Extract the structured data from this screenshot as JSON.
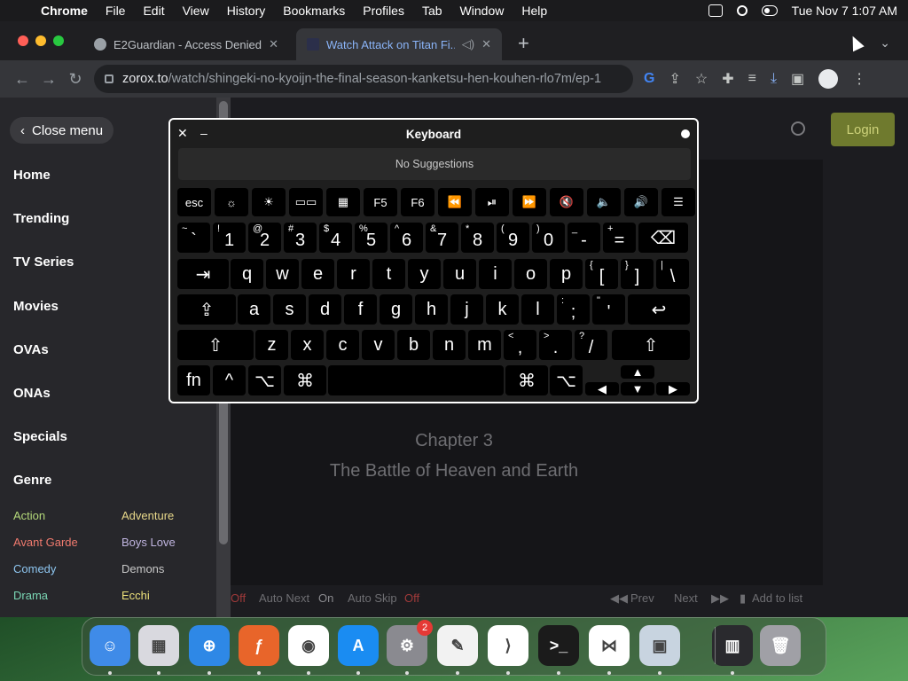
{
  "menubar": {
    "app_name": "Chrome",
    "items": [
      "File",
      "Edit",
      "View",
      "History",
      "Bookmarks",
      "Profiles",
      "Tab",
      "Window",
      "Help"
    ],
    "datetime": "Tue Nov 7  1:07 AM"
  },
  "browser": {
    "tabs": [
      {
        "title": "E2Guardian - Access Denied",
        "active": false
      },
      {
        "title": "Watch Attack on Titan Fi...",
        "active": true
      }
    ],
    "new_tab": "+",
    "url_host": "zorox.to",
    "url_path": "/watch/shingeki-no-kyoijn-the-final-season-kanketsu-hen-kouhen-rlo7m/ep-1"
  },
  "site": {
    "close_menu": "Close menu",
    "nav": [
      "Home",
      "Trending",
      "TV Series",
      "Movies",
      "OVAs",
      "ONAs",
      "Specials",
      "Genre"
    ],
    "genres_left": [
      "Action",
      "Avant Garde",
      "Comedy",
      "Drama"
    ],
    "genres_right": [
      "Adventure",
      "Boys Love",
      "Demons",
      "Ecchi"
    ],
    "genre_colors": {
      "Action": "#b4d97a",
      "Adventure": "#e8d88a",
      "Avant Garde": "#f07a6e",
      "Boys Love": "#c0b5e0",
      "Comedy": "#8ec6f0",
      "Demons": "#c8c8c8",
      "Drama": "#7ad6b4",
      "Ecchi": "#ece07a"
    },
    "login": "Login",
    "chapter": "Chapter 3",
    "chapter_title": "The Battle of Heaven and Earth",
    "controls": {
      "off1": "Off",
      "auto_next": "Auto Next",
      "auto_next_state": "On",
      "auto_skip": "Auto Skip",
      "auto_skip_state": "Off",
      "prev": "Prev",
      "next": "Next",
      "add_to_list": "Add to list"
    }
  },
  "keyboard": {
    "title": "Keyboard",
    "suggestions": "No Suggestions",
    "row_fn": [
      "esc",
      "☼",
      "☀",
      "▭▭",
      "▦",
      "F5",
      "F6",
      "⏪",
      "⏯",
      "⏩",
      "🔇",
      "🔈",
      "🔊",
      "☰"
    ],
    "row_num": [
      {
        "top": "~",
        "ch": "`"
      },
      {
        "top": "!",
        "ch": "1"
      },
      {
        "top": "@",
        "ch": "2"
      },
      {
        "top": "#",
        "ch": "3"
      },
      {
        "top": "$",
        "ch": "4"
      },
      {
        "top": "%",
        "ch": "5"
      },
      {
        "top": "^",
        "ch": "6"
      },
      {
        "top": "&",
        "ch": "7"
      },
      {
        "top": "*",
        "ch": "8"
      },
      {
        "top": "(",
        "ch": "9"
      },
      {
        "top": ")",
        "ch": "0"
      },
      {
        "top": "_",
        "ch": "-"
      },
      {
        "top": "+",
        "ch": "="
      },
      {
        "top": "",
        "ch": "⌫"
      }
    ],
    "row_q": [
      "⇥",
      "q",
      "w",
      "e",
      "r",
      "t",
      "y",
      "u",
      "i",
      "o",
      "p",
      "{[",
      "}]",
      "|\\"
    ],
    "row_a": [
      "⇪",
      "a",
      "s",
      "d",
      "f",
      "g",
      "h",
      "j",
      "k",
      "l",
      ":;",
      "\"'",
      "↩"
    ],
    "row_z": [
      "⇧",
      "z",
      "x",
      "c",
      "v",
      "b",
      "n",
      "m",
      "<,",
      ">.",
      "?/",
      "⇧"
    ],
    "row_bottom": [
      "fn",
      "^",
      "⌥",
      "⌘",
      "",
      "⌘",
      "⌥"
    ],
    "arrows": [
      "▲",
      "◀",
      "▼",
      "▶"
    ]
  },
  "dock": {
    "apps": [
      "Finder",
      "Launchpad",
      "Safari",
      "Firefox",
      "Chrome",
      "App Store",
      "System Settings",
      "TextEdit",
      "VS Code",
      "Terminal",
      "Visual Studio",
      "Preview",
      "Screenshot",
      "Trash"
    ],
    "settings_badge": "2"
  }
}
